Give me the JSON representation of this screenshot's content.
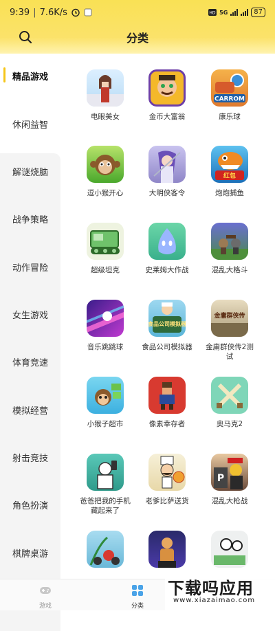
{
  "status_bar": {
    "time": "9:39",
    "speed": "7.6K/s",
    "network": "5G",
    "battery": "87"
  },
  "header": {
    "title": "分类"
  },
  "sidebar": {
    "items": [
      {
        "label": "精品游戏"
      },
      {
        "label": "休闲益智"
      },
      {
        "label": "解谜烧脑"
      },
      {
        "label": "战争策略"
      },
      {
        "label": "动作冒险"
      },
      {
        "label": "女生游戏"
      },
      {
        "label": "体育竞速"
      },
      {
        "label": "模拟经营"
      },
      {
        "label": "射击竞技"
      },
      {
        "label": "角色扮演"
      },
      {
        "label": "棋牌桌游"
      }
    ]
  },
  "games": [
    {
      "name": "电眼美女"
    },
    {
      "name": "金币大富翁"
    },
    {
      "name": "康乐球",
      "icon_text": "CARROM"
    },
    {
      "name": "逗小猴开心"
    },
    {
      "name": "大明侠客令"
    },
    {
      "name": "炮炮捕鱼",
      "icon_text": "红包"
    },
    {
      "name": "超级坦克"
    },
    {
      "name": "史莱姆大作战"
    },
    {
      "name": "混乱大格斗"
    },
    {
      "name": "音乐跳跳球"
    },
    {
      "name": "食品公司模拟器",
      "icon_text": "食品公司模拟器"
    },
    {
      "name": "金庸群侠传2测试",
      "icon_text": "金庸群侠传"
    },
    {
      "name": "小猴子超市"
    },
    {
      "name": "像素幸存者"
    },
    {
      "name": "奥马克2"
    },
    {
      "name": "爸爸把我的手机藏起来了"
    },
    {
      "name": "老爹比萨送货"
    },
    {
      "name": "混乱大枪战",
      "icon_text": "P"
    },
    {
      "name": ""
    },
    {
      "name": ""
    },
    {
      "name": ""
    }
  ],
  "bottom_nav": {
    "items": [
      {
        "label": "游戏"
      },
      {
        "label": "分类"
      }
    ]
  },
  "watermark": {
    "title": "下载吗应用",
    "url": "www.xiazaimao.com"
  }
}
